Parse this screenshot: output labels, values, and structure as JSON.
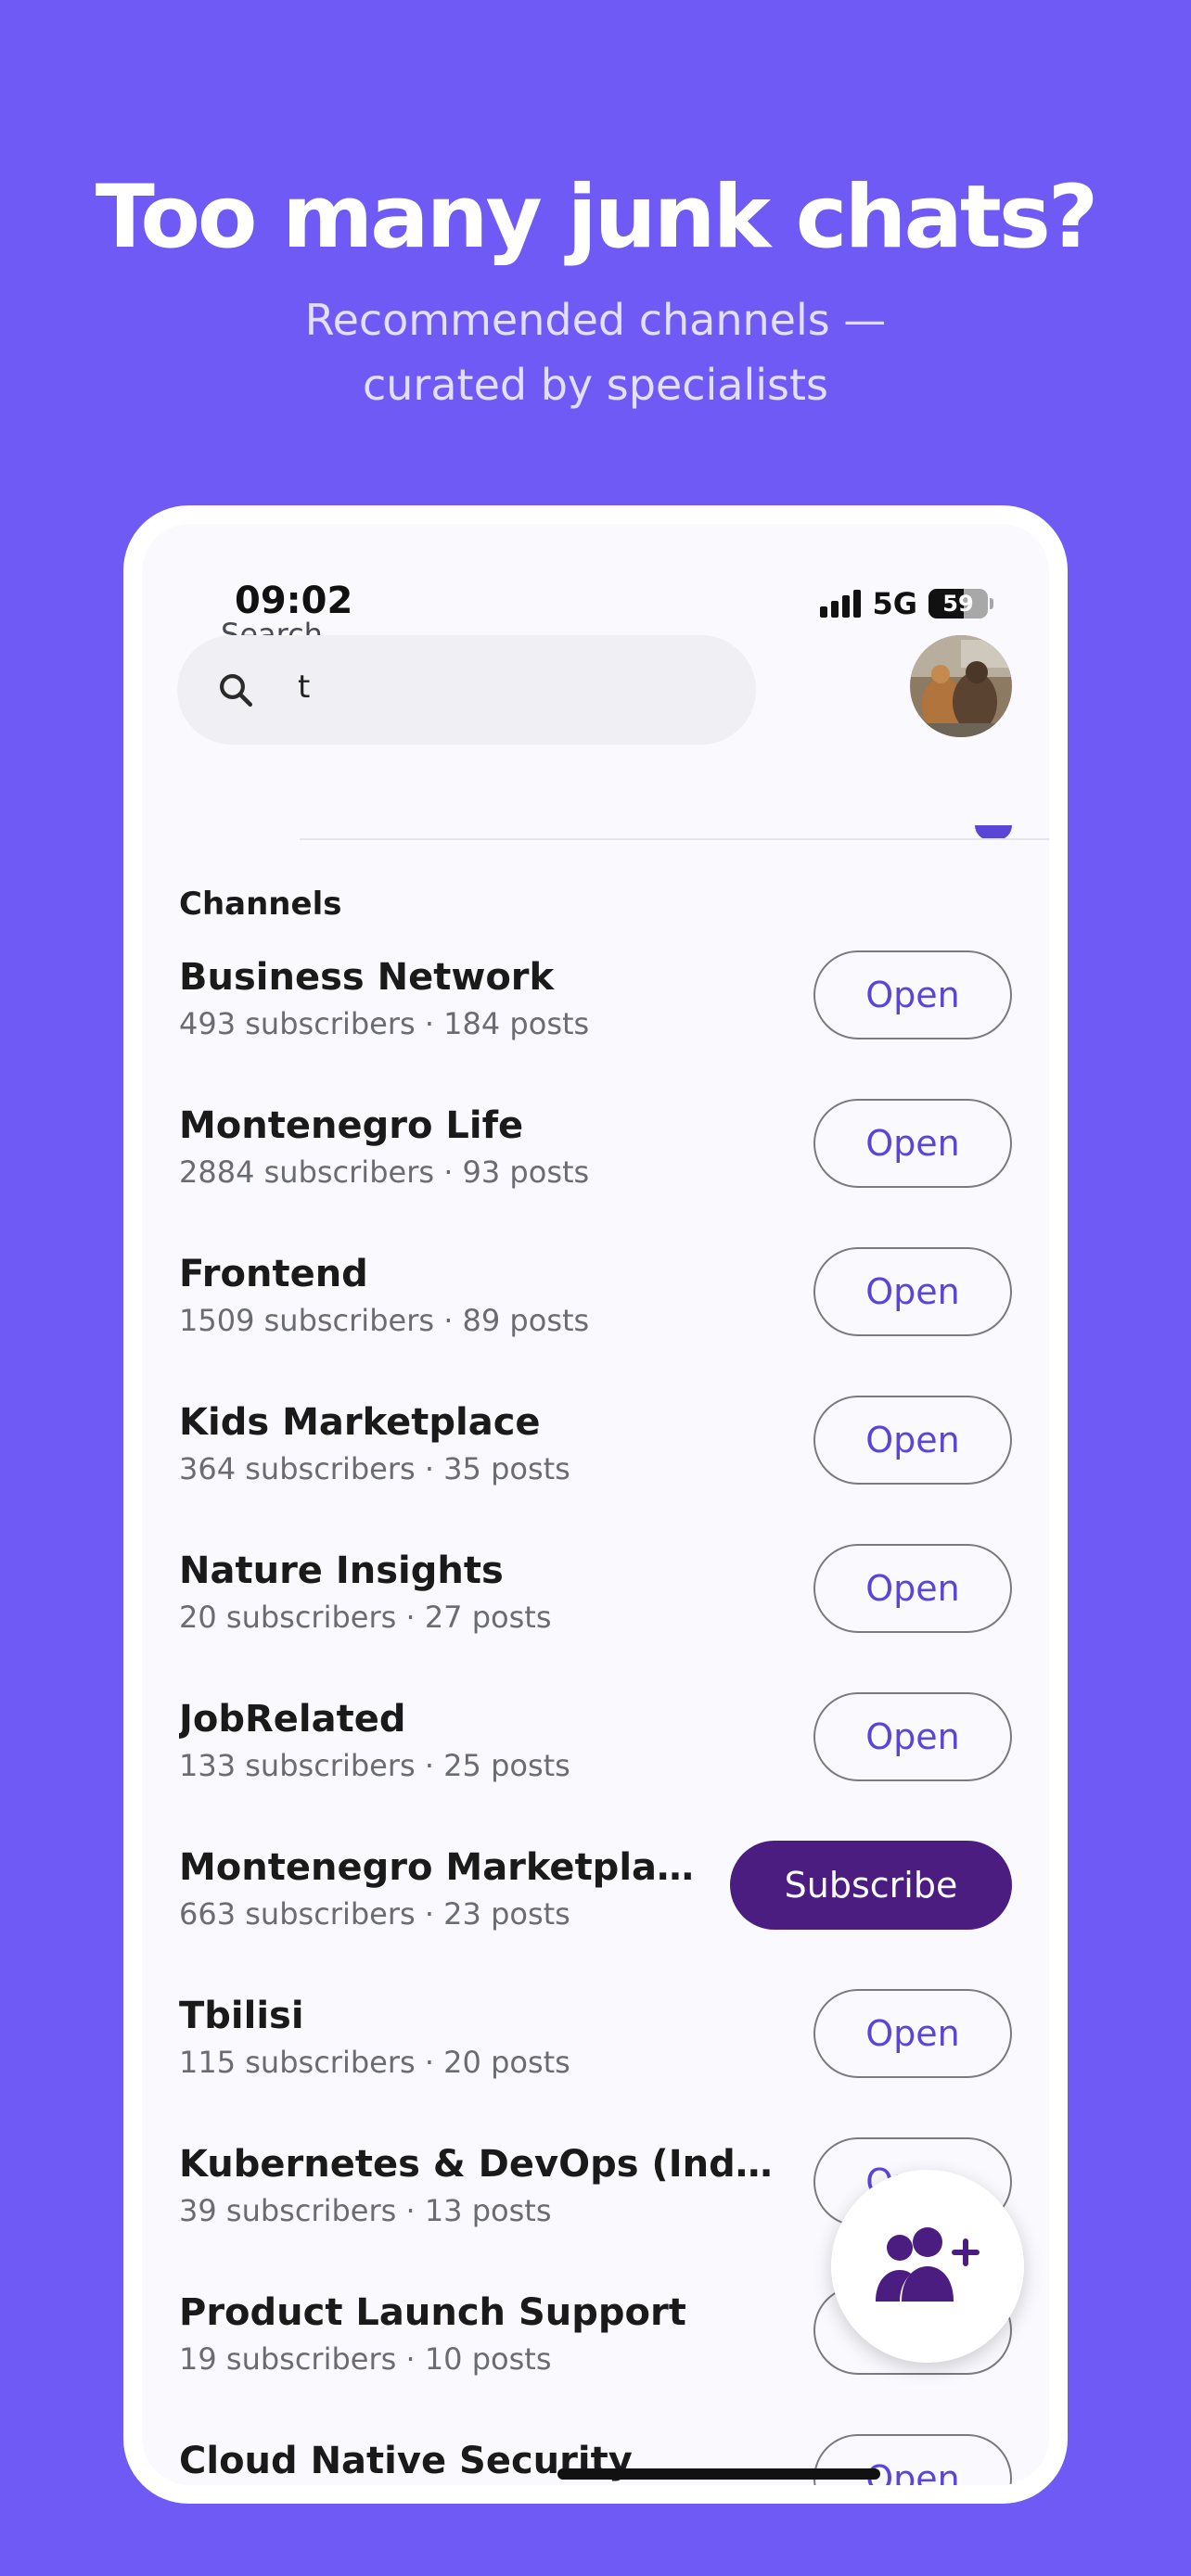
{
  "promo": {
    "headline": "Too many junk chats?",
    "subtitle_line1": "Recommended channels —",
    "subtitle_line2": "curated by specialists"
  },
  "status_bar": {
    "time": "09:02",
    "network": "5G",
    "battery": "59",
    "battery_level": 0.59
  },
  "search": {
    "label": "Search",
    "value": "t",
    "icon": "search-icon"
  },
  "avatar": {
    "icon": "user-avatar"
  },
  "section": {
    "title": "Channels"
  },
  "channels": [
    {
      "name": "Business Network",
      "meta": "493 subscribers · 184 posts",
      "action": "Open"
    },
    {
      "name": "Montenegro Life",
      "meta": "2884 subscribers · 93 posts",
      "action": "Open"
    },
    {
      "name": "Frontend",
      "meta": "1509 subscribers · 89 posts",
      "action": "Open"
    },
    {
      "name": "Kids Marketplace",
      "meta": "364 subscribers · 35 posts",
      "action": "Open"
    },
    {
      "name": "Nature Insights",
      "meta": "20 subscribers · 27 posts",
      "action": "Open"
    },
    {
      "name": "JobRelated",
      "meta": "133 subscribers · 25 posts",
      "action": "Open"
    },
    {
      "name": "Montenegro Marketplace",
      "meta": "663 subscribers · 23 posts",
      "action": "Subscribe"
    },
    {
      "name": "Tbilisi",
      "meta": "115 subscribers · 20 posts",
      "action": "Open"
    },
    {
      "name": "Kubernetes & DevOps (Indonesia)",
      "meta": "39 subscribers · 13 posts",
      "action": "Open"
    },
    {
      "name": "Product Launch Support",
      "meta": "19 subscribers · 10 posts",
      "action": "Open"
    },
    {
      "name": "Cloud Native Security",
      "meta": "",
      "action": "Open"
    }
  ],
  "fab": {
    "icon": "add-user-icon"
  },
  "colors": {
    "background": "#6F5AF5",
    "accent": "#5B45D8",
    "subscribe": "#4C1D80",
    "screen": "#F9F9FE"
  }
}
